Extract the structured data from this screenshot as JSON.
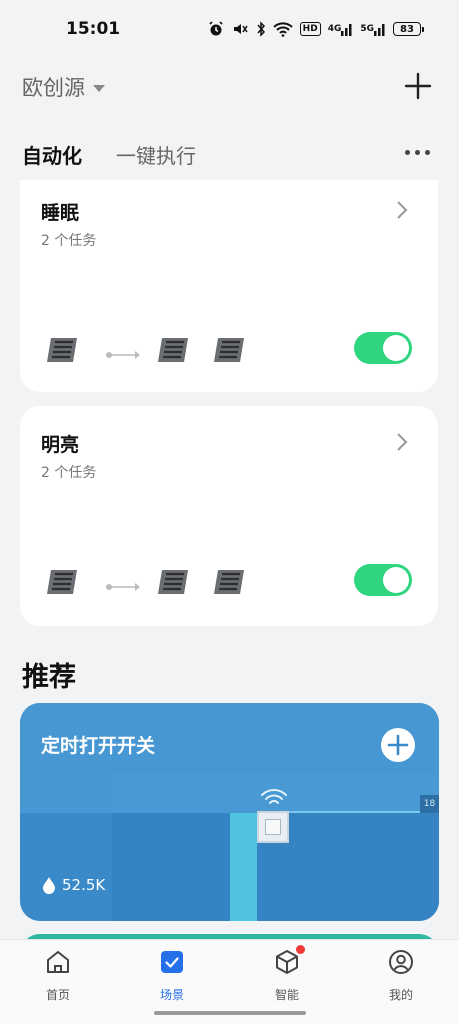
{
  "status_bar": {
    "time": "15:01",
    "battery": "83",
    "hd_label": "HD",
    "signal_1": "4G",
    "signal_2": "5G"
  },
  "header": {
    "home_name": "欧创源"
  },
  "tabs": [
    {
      "label": "自动化",
      "active": true
    },
    {
      "label": "一键执行",
      "active": false
    }
  ],
  "scenes": [
    {
      "title": "睡眠",
      "subtitle": "2 个任务",
      "enabled": true
    },
    {
      "title": "明亮",
      "subtitle": "2 个任务",
      "enabled": true
    }
  ],
  "recommend": {
    "section_title": "推荐",
    "card_title": "定时打开开关",
    "stat_value": "52.5K",
    "badge": "18"
  },
  "bottom_nav": [
    {
      "label": "首页",
      "icon": "home-icon",
      "active": false
    },
    {
      "label": "场景",
      "icon": "scene-check-icon",
      "active": true
    },
    {
      "label": "智能",
      "icon": "cube-icon",
      "active": false
    },
    {
      "label": "我的",
      "icon": "profile-icon",
      "active": false
    }
  ],
  "colors": {
    "accent": "#2570e8",
    "toggle_on": "#2fd57f",
    "recommend_card": "#3a89c9",
    "notification_dot": "#f03a3a"
  }
}
